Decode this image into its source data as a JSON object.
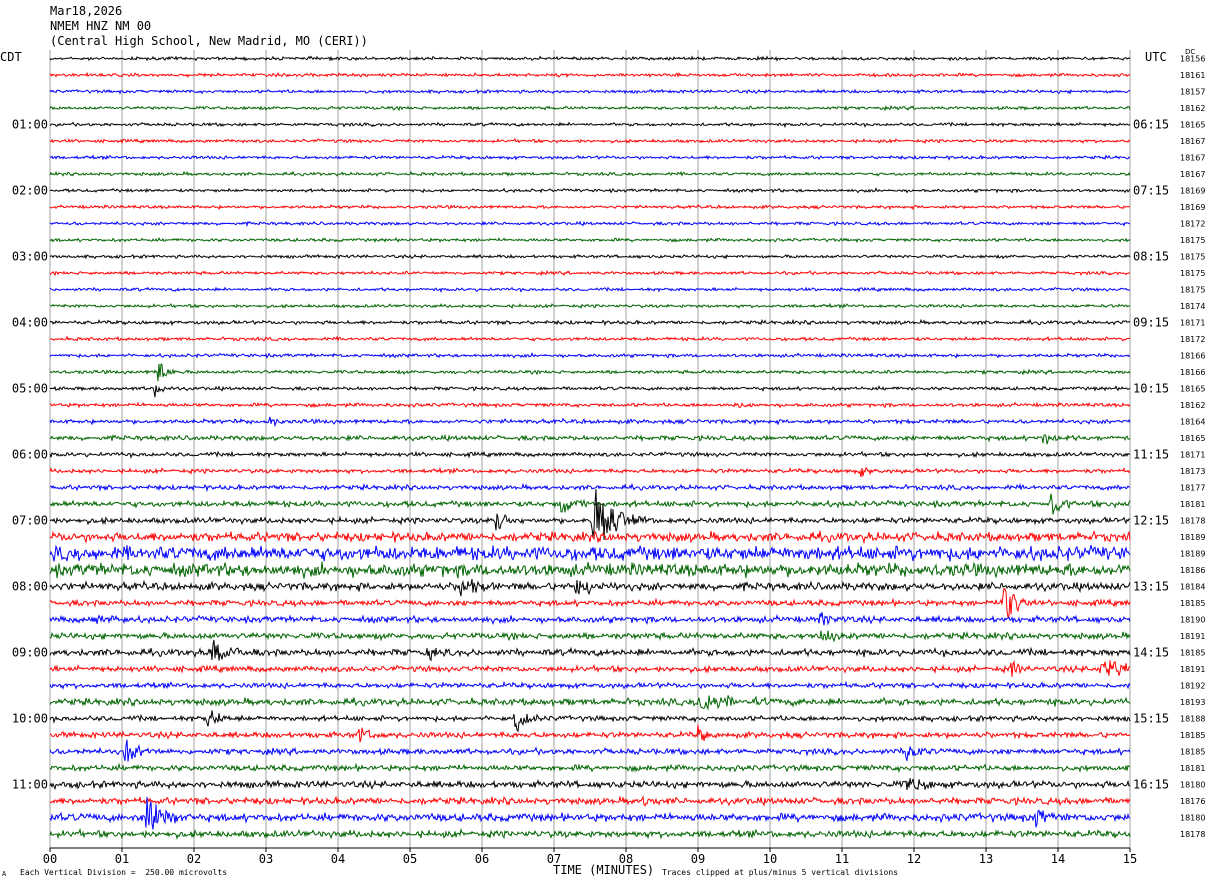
{
  "header": {
    "date": "Mar18,2026",
    "station": "NMEM HNZ NM 00",
    "location": "(Central High School, New Madrid, MO (CERI))"
  },
  "labels": {
    "left_tz": "CDT",
    "right_tz": "UTC",
    "dc_label": "DC",
    "footer_left": "Each Vertical Division =  250.00 microvolts",
    "footer_center": "TIME (MINUTES)",
    "footer_right": "Traces clipped at plus/minus 5 vertical divisions",
    "corner_mark": "A"
  },
  "colors": {
    "trace_cycle": [
      "#000000",
      "#ff0000",
      "#0000ff",
      "#006400"
    ],
    "grid": "#a0a0a0"
  },
  "chart_data": {
    "type": "line",
    "xlabel": "TIME (MINUTES)",
    "xlim": [
      0,
      15
    ],
    "x_ticks": [
      "00",
      "01",
      "02",
      "03",
      "04",
      "05",
      "06",
      "07",
      "08",
      "09",
      "10",
      "11",
      "12",
      "13",
      "14",
      "15"
    ],
    "left_time_labels": [
      {
        "row": 4,
        "label": "01:00"
      },
      {
        "row": 8,
        "label": "02:00"
      },
      {
        "row": 12,
        "label": "03:00"
      },
      {
        "row": 16,
        "label": "04:00"
      },
      {
        "row": 20,
        "label": "05:00"
      },
      {
        "row": 24,
        "label": "06:00"
      },
      {
        "row": 28,
        "label": "07:00"
      },
      {
        "row": 32,
        "label": "08:00"
      },
      {
        "row": 36,
        "label": "09:00"
      },
      {
        "row": 40,
        "label": "10:00"
      },
      {
        "row": 44,
        "label": "11:00"
      }
    ],
    "right_time_labels": [
      {
        "row": 4,
        "label": "06:15"
      },
      {
        "row": 8,
        "label": "07:15"
      },
      {
        "row": 12,
        "label": "08:15"
      },
      {
        "row": 16,
        "label": "09:15"
      },
      {
        "row": 20,
        "label": "10:15"
      },
      {
        "row": 24,
        "label": "11:15"
      },
      {
        "row": 28,
        "label": "12:15"
      },
      {
        "row": 32,
        "label": "13:15"
      },
      {
        "row": 36,
        "label": "14:15"
      },
      {
        "row": 40,
        "label": "15:15"
      },
      {
        "row": 44,
        "label": "16:15"
      }
    ],
    "dc_offsets": [
      "18156",
      "18161",
      "18157",
      "18162",
      "18165",
      "18167",
      "18167",
      "18167",
      "18169",
      "18169",
      "18172",
      "18175",
      "18175",
      "18175",
      "18175",
      "18174",
      "18171",
      "18172",
      "18166",
      "18166",
      "18165",
      "18162",
      "18164",
      "18165",
      "18171",
      "18173",
      "18177",
      "18181",
      "18178",
      "18189",
      "18189",
      "18186",
      "18184",
      "18185",
      "18190",
      "18191",
      "18185",
      "18191",
      "18192",
      "18193",
      "18188",
      "18185",
      "18185",
      "18181",
      "18180",
      "18176",
      "18180",
      "18178"
    ],
    "trace_noise": [
      1.2,
      1.2,
      1.2,
      1.2,
      1.2,
      1.2,
      1.2,
      1.2,
      1.2,
      1.2,
      1.2,
      1.2,
      1.2,
      1.2,
      1.2,
      1.2,
      1.4,
      1.3,
      1.3,
      1.3,
      1.3,
      1.4,
      1.6,
      1.8,
      1.6,
      1.6,
      1.8,
      2.2,
      2.2,
      3.5,
      5.5,
      5.0,
      3.0,
      2.2,
      2.4,
      2.4,
      2.6,
      2.2,
      2.0,
      2.6,
      2.0,
      2.2,
      2.2,
      2.2,
      2.6,
      2.6,
      3.0,
      2.6
    ],
    "events": [
      {
        "row": 19,
        "x": 1.5,
        "amp": 12,
        "dur": 0.12
      },
      {
        "row": 20,
        "x": 1.45,
        "amp": 10,
        "dur": 0.1
      },
      {
        "row": 21,
        "x": 9.5,
        "amp": 4,
        "dur": 0.15
      },
      {
        "row": 22,
        "x": 3.05,
        "amp": 6,
        "dur": 0.1
      },
      {
        "row": 23,
        "x": 13.8,
        "amp": 8,
        "dur": 0.12
      },
      {
        "row": 25,
        "x": 11.25,
        "amp": 9,
        "dur": 0.1
      },
      {
        "row": 27,
        "x": 7.1,
        "amp": 12,
        "dur": 0.2
      },
      {
        "row": 27,
        "x": 13.9,
        "amp": 12,
        "dur": 0.15
      },
      {
        "row": 27,
        "x": 15.0,
        "amp": 12,
        "dur": 0.15
      },
      {
        "row": 28,
        "x": 7.55,
        "amp": 40,
        "dur": 0.25
      },
      {
        "row": 28,
        "x": 6.2,
        "amp": 12,
        "dur": 0.15
      },
      {
        "row": 32,
        "x": 5.7,
        "amp": 12,
        "dur": 0.2
      },
      {
        "row": 32,
        "x": 7.3,
        "amp": 12,
        "dur": 0.2
      },
      {
        "row": 33,
        "x": 13.25,
        "amp": 22,
        "dur": 0.2
      },
      {
        "row": 34,
        "x": 0.6,
        "amp": 8,
        "dur": 0.15
      },
      {
        "row": 34,
        "x": 10.7,
        "amp": 8,
        "dur": 0.15
      },
      {
        "row": 35,
        "x": 10.7,
        "amp": 10,
        "dur": 0.15
      },
      {
        "row": 36,
        "x": 2.25,
        "amp": 14,
        "dur": 0.2
      },
      {
        "row": 36,
        "x": 5.25,
        "amp": 10,
        "dur": 0.12
      },
      {
        "row": 37,
        "x": 14.6,
        "amp": 16,
        "dur": 0.25
      },
      {
        "row": 37,
        "x": 13.35,
        "amp": 10,
        "dur": 0.1
      },
      {
        "row": 39,
        "x": 9.0,
        "amp": 10,
        "dur": 0.5
      },
      {
        "row": 40,
        "x": 2.2,
        "amp": 12,
        "dur": 0.15
      },
      {
        "row": 40,
        "x": 6.45,
        "amp": 16,
        "dur": 0.15
      },
      {
        "row": 41,
        "x": 4.3,
        "amp": 10,
        "dur": 0.12
      },
      {
        "row": 41,
        "x": 9.0,
        "amp": 10,
        "dur": 0.12
      },
      {
        "row": 42,
        "x": 1.05,
        "amp": 14,
        "dur": 0.15
      },
      {
        "row": 42,
        "x": 11.9,
        "amp": 10,
        "dur": 0.15
      },
      {
        "row": 44,
        "x": 11.9,
        "amp": 10,
        "dur": 0.2
      },
      {
        "row": 46,
        "x": 1.35,
        "amp": 30,
        "dur": 0.2
      },
      {
        "row": 46,
        "x": 13.7,
        "amp": 10,
        "dur": 0.15
      },
      {
        "row": 45,
        "x": 8.25,
        "amp": 10,
        "dur": 0.12
      }
    ]
  }
}
